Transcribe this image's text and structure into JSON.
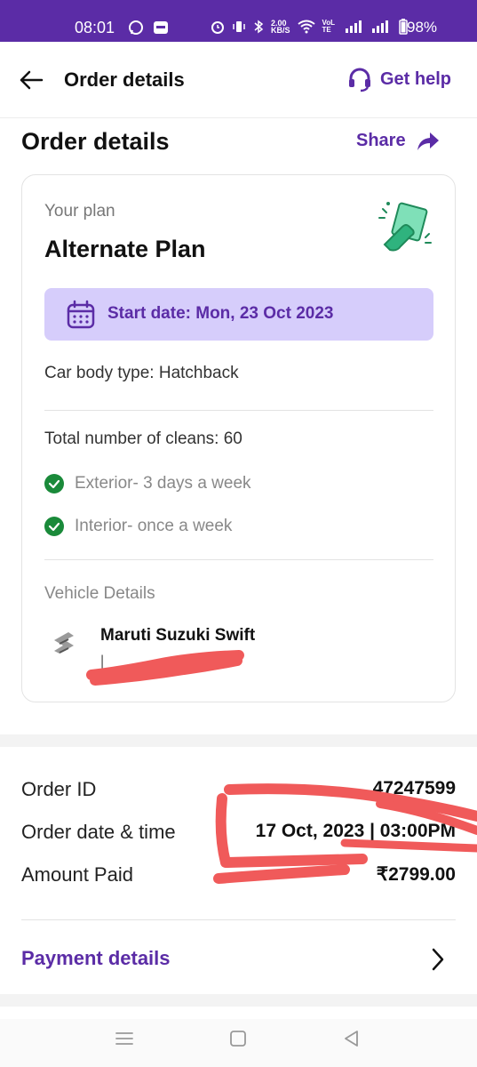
{
  "status_bar": {
    "time": "08:01",
    "network_speed": "2.00",
    "network_unit": "KB/S",
    "carrier_label": "VoLTE",
    "battery": "98%"
  },
  "appbar": {
    "title": "Order details",
    "help_label": "Get help",
    "back_icon": "arrow-left-icon",
    "help_icon": "headset-icon"
  },
  "section": {
    "title": "Order details",
    "share_label": "Share",
    "share_icon": "share-arrow-icon"
  },
  "plan": {
    "kicker": "Your plan",
    "name": "Alternate Plan",
    "illustration": "cleaning-cloth-icon",
    "start_date": "Start date: Mon, 23 Oct 2023",
    "body_type": "Car body type: Hatchback",
    "cleans_total": "Total number of cleans: 60",
    "clean_items": [
      {
        "label": "Exterior- 3 days a week"
      },
      {
        "label": "Interior- once a week"
      }
    ]
  },
  "vehicle": {
    "heading": "Vehicle Details",
    "name": "Maruti Suzuki Swift",
    "plate": "|",
    "brand_icon": "suzuki-logo-icon"
  },
  "order": {
    "rows": [
      {
        "label": "Order ID",
        "value": "47247599"
      },
      {
        "label": "Order date & time",
        "value": "17 Oct, 2023 | 03:00PM"
      },
      {
        "label": "Amount Paid",
        "value": "₹2799.00"
      }
    ]
  },
  "payment": {
    "label": "Payment details"
  },
  "colors": {
    "brand": "#5b2ca6",
    "highlight_bg": "#d6cdfb",
    "success": "#1a8a3a",
    "redaction": "#f05a5a"
  }
}
